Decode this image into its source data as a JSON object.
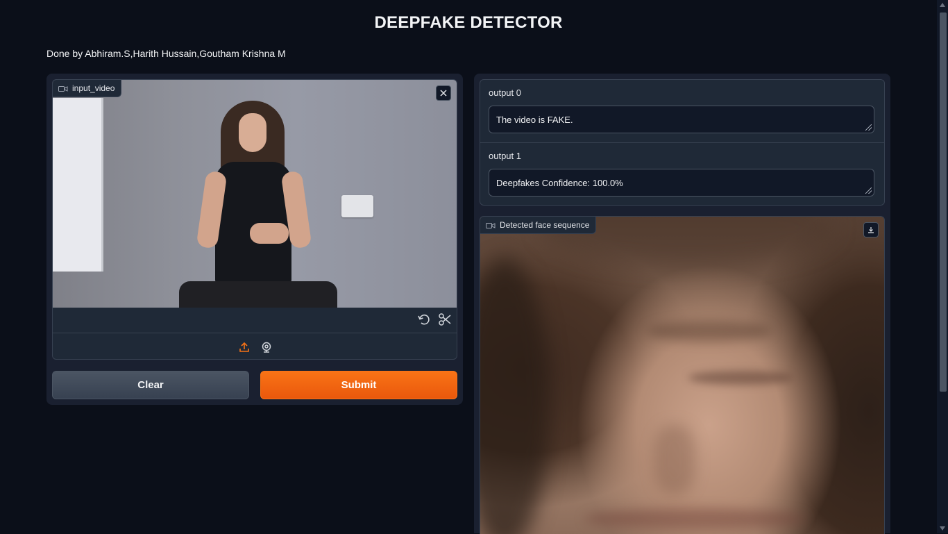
{
  "header": {
    "title": "DEEPFAKE DETECTOR",
    "credits": "Done by Abhiram.S,Harith Hussain,Goutham Krishna M"
  },
  "input_panel": {
    "video_label": "input_video",
    "buttons": {
      "clear_label": "Clear",
      "submit_label": "Submit"
    }
  },
  "outputs": [
    {
      "label": "output 0",
      "value": "The video is FAKE."
    },
    {
      "label": "output 1",
      "value": "Deepfakes Confidence: 100.0%"
    }
  ],
  "face_panel": {
    "label": "Detected face sequence"
  },
  "colors": {
    "background": "#0b0f19",
    "panel": "#1a2030",
    "accent": "#f97316"
  },
  "icons": [
    "video-camera-icon",
    "close-icon",
    "undo-icon",
    "scissors-icon",
    "upload-icon",
    "webcam-icon",
    "download-icon"
  ]
}
